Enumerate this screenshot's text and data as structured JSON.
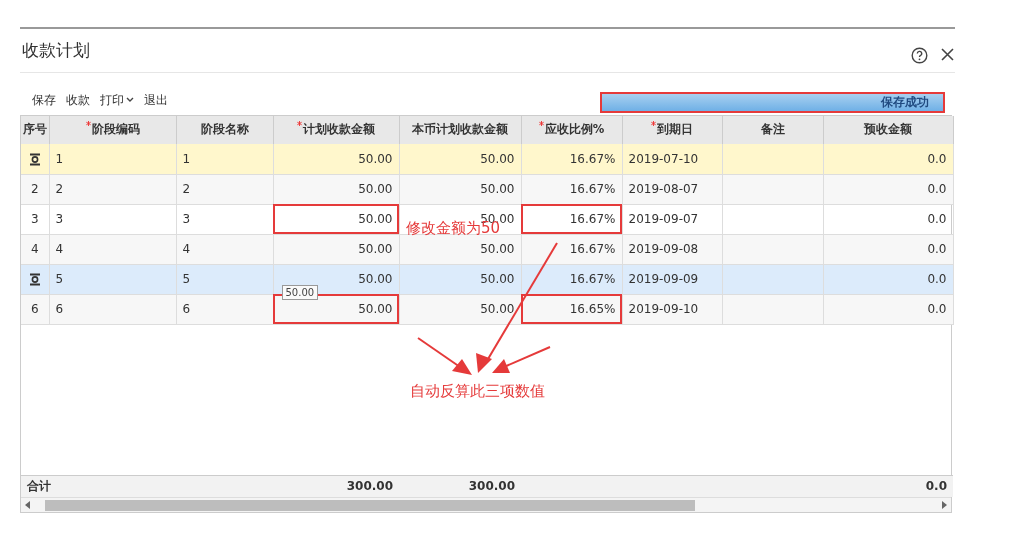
{
  "dialog": {
    "title": "收款计划"
  },
  "toolbar": [
    {
      "label": "保存",
      "dropdown": false
    },
    {
      "label": "收款",
      "dropdown": false
    },
    {
      "label": "打印",
      "dropdown": true
    },
    {
      "label": "退出",
      "dropdown": false
    }
  ],
  "toast": {
    "text": "保存成功"
  },
  "table": {
    "columns": [
      {
        "label": "序号",
        "required": false
      },
      {
        "label": "阶段编码",
        "required": true
      },
      {
        "label": "阶段名称",
        "required": false
      },
      {
        "label": "计划收款金额",
        "required": true
      },
      {
        "label": "本币计划收款金额",
        "required": false
      },
      {
        "label": "应收比例%",
        "required": true
      },
      {
        "label": "到期日",
        "required": true
      },
      {
        "label": "备注",
        "required": false
      },
      {
        "label": "预收金额",
        "required": false
      }
    ],
    "rows": [
      {
        "current": true,
        "selected": false,
        "marked": true,
        "cells": [
          {
            "boxed": false
          },
          {
            "text": "1",
            "boxed": false
          },
          {
            "text": "1",
            "boxed": false
          },
          {
            "text": "50.00",
            "boxed": false
          },
          {
            "text": "50.00",
            "boxed": false
          },
          {
            "text": "16.67%",
            "boxed": false
          },
          {
            "text": "2019-07-10",
            "boxed": false
          },
          {
            "boxed": false
          },
          {
            "text": "0.0",
            "boxed": false
          }
        ]
      },
      {
        "current": false,
        "selected": false,
        "marked": false,
        "cells": [
          {
            "text": "2",
            "boxed": false
          },
          {
            "text": "2",
            "boxed": false
          },
          {
            "text": "2",
            "boxed": false
          },
          {
            "text": "50.00",
            "boxed": false
          },
          {
            "text": "50.00",
            "boxed": false
          },
          {
            "text": "16.67%",
            "boxed": false
          },
          {
            "text": "2019-08-07",
            "boxed": false
          },
          {
            "boxed": false
          },
          {
            "text": "0.0",
            "boxed": false
          }
        ]
      },
      {
        "current": false,
        "selected": false,
        "marked": false,
        "cells": [
          {
            "text": "3",
            "boxed": false
          },
          {
            "text": "3",
            "boxed": false
          },
          {
            "text": "3",
            "boxed": false
          },
          {
            "text": "50.00",
            "boxed": true
          },
          {
            "text": "50.00",
            "boxed": false
          },
          {
            "text": "16.67%",
            "boxed": true
          },
          {
            "text": "2019-09-07",
            "boxed": false
          },
          {
            "boxed": false
          },
          {
            "text": "0.0",
            "boxed": false
          }
        ]
      },
      {
        "current": false,
        "selected": false,
        "marked": false,
        "cells": [
          {
            "text": "4",
            "boxed": false
          },
          {
            "text": "4",
            "boxed": false
          },
          {
            "text": "4",
            "boxed": false
          },
          {
            "text": "50.00",
            "boxed": false
          },
          {
            "text": "50.00",
            "boxed": false
          },
          {
            "text": "16.67%",
            "boxed": false
          },
          {
            "text": "2019-09-08",
            "boxed": false
          },
          {
            "boxed": false
          },
          {
            "text": "0.0",
            "boxed": false
          }
        ]
      },
      {
        "current": false,
        "selected": true,
        "marked": true,
        "cells": [
          {
            "boxed": false
          },
          {
            "text": "5",
            "boxed": false
          },
          {
            "text": "5",
            "boxed": false
          },
          {
            "text": "50.00",
            "boxed": false
          },
          {
            "text": "50.00",
            "boxed": false
          },
          {
            "text": "16.67%",
            "boxed": false
          },
          {
            "text": "2019-09-09",
            "boxed": false
          },
          {
            "boxed": false
          },
          {
            "text": "0.0",
            "boxed": false
          }
        ]
      },
      {
        "current": false,
        "selected": false,
        "marked": false,
        "cells": [
          {
            "text": "6",
            "boxed": false
          },
          {
            "text": "6",
            "boxed": false
          },
          {
            "text": "6",
            "boxed": false
          },
          {
            "text": "50.00",
            "boxed": true,
            "tooltip": "50.00"
          },
          {
            "text": "50.00",
            "boxed": false
          },
          {
            "text": "16.65%",
            "boxed": true
          },
          {
            "text": "2019-09-10",
            "boxed": false
          },
          {
            "boxed": false
          },
          {
            "text": "0.0",
            "boxed": false
          }
        ]
      }
    ],
    "totals": {
      "label": "合计",
      "plan_amount": "300.00",
      "local_amount": "300.00",
      "advance": "0.0"
    }
  },
  "annotations": [
    {
      "text": "修改金额为50"
    },
    {
      "text": "自动反算此三项数值"
    }
  ]
}
